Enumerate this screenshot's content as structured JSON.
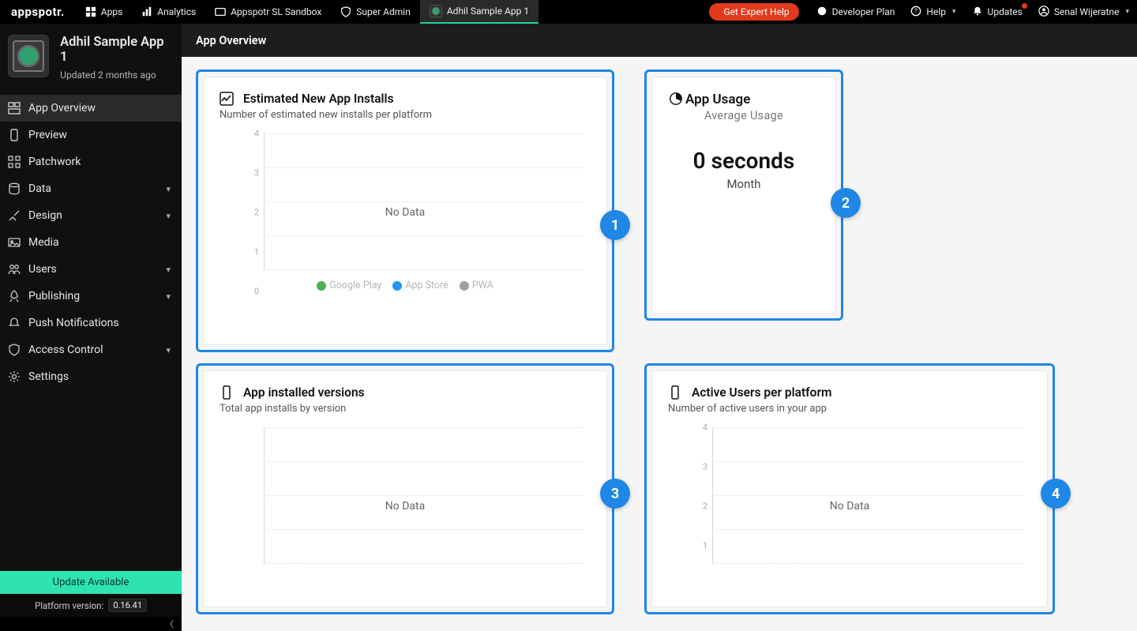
{
  "brand": "appspotr.",
  "topnav": {
    "apps": "Apps",
    "analytics": "Analytics",
    "sandbox": "Appspotr SL Sandbox",
    "superadmin": "Super Admin",
    "currentApp": "Adhil Sample App 1"
  },
  "topright": {
    "expert": "Get Expert Help",
    "plan": "Developer Plan",
    "help": "Help",
    "updates": "Updates",
    "user": "Senal Wijeratne"
  },
  "app": {
    "name": "Adhil Sample App 1",
    "updated": "Updated 2 months ago"
  },
  "sidebar": {
    "items": [
      {
        "label": "App Overview"
      },
      {
        "label": "Preview"
      },
      {
        "label": "Patchwork"
      },
      {
        "label": "Data"
      },
      {
        "label": "Design"
      },
      {
        "label": "Media"
      },
      {
        "label": "Users"
      },
      {
        "label": "Publishing"
      },
      {
        "label": "Push Notifications"
      },
      {
        "label": "Access Control"
      },
      {
        "label": "Settings"
      }
    ],
    "update_banner": "Update Available",
    "platform_label": "Platform version:",
    "platform_version": "0.16.41"
  },
  "page": {
    "title": "App Overview"
  },
  "cards": {
    "installs": {
      "title": "Estimated New App Installs",
      "subtitle": "Number of estimated new installs per platform",
      "nodata": "No Data",
      "legend": {
        "gp": "Google Play",
        "as": "App Store",
        "pwa": "PWA"
      }
    },
    "usage": {
      "title": "App Usage",
      "subtitle": "Average Usage",
      "value": "0 seconds",
      "period": "Month"
    },
    "versions": {
      "title": "App installed versions",
      "subtitle": "Total app installs by version",
      "nodata": "No Data"
    },
    "active": {
      "title": "Active Users per platform",
      "subtitle": "Number of active users in your app",
      "nodata": "No Data"
    }
  },
  "tour": {
    "b1": "1",
    "b2": "2",
    "b3": "3",
    "b4": "4"
  },
  "colors": {
    "gp": "#4caf50",
    "as": "#2196f3",
    "pwa": "#9e9e9e",
    "tour": "#1f87e5",
    "brand_green": "#2fe3b0"
  },
  "chart_data": [
    {
      "id": "installs",
      "type": "bar",
      "title": "Estimated New App Installs",
      "xlabel": "",
      "ylabel": "",
      "ylim": [
        0,
        4
      ],
      "yticks": [
        0,
        1,
        2,
        3,
        4
      ],
      "categories": [],
      "series": [
        {
          "name": "Google Play",
          "values": []
        },
        {
          "name": "App Store",
          "values": []
        },
        {
          "name": "PWA",
          "values": []
        }
      ],
      "empty": true
    },
    {
      "id": "versions",
      "type": "bar",
      "title": "App installed versions",
      "ylim": [
        0,
        4
      ],
      "yticks": [
        0,
        1,
        2,
        3,
        4
      ],
      "categories": [],
      "series": [],
      "empty": true
    },
    {
      "id": "active_users",
      "type": "bar",
      "title": "Active Users per platform",
      "ylim": [
        0,
        4
      ],
      "yticks": [
        0,
        1,
        2,
        3,
        4
      ],
      "categories": [],
      "series": [],
      "empty": true
    }
  ]
}
